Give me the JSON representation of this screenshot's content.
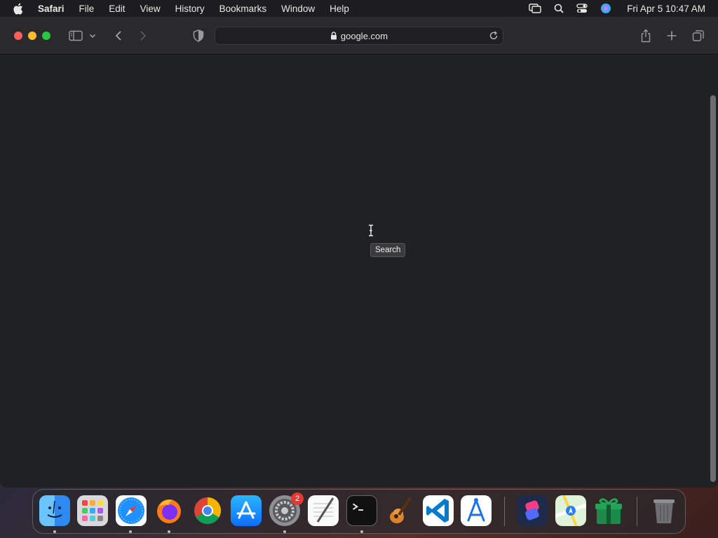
{
  "menubar": {
    "app_name": "Safari",
    "items": [
      "File",
      "Edit",
      "View",
      "History",
      "Bookmarks",
      "Window",
      "Help"
    ],
    "clock": "Fri Apr 5  10:47 AM"
  },
  "toolbar": {
    "url": "google.com"
  },
  "tooltip": {
    "text": "Search"
  },
  "dock": {
    "items": [
      "Finder",
      "Launchpad",
      "Safari",
      "Firefox",
      "Google Chrome",
      "App Store",
      "System Settings",
      "TextEdit",
      "Terminal",
      "GarageBand",
      "Visual Studio Code",
      "Xcode Instruments",
      "Shortcuts",
      "Maps",
      "Gift",
      "Trash"
    ],
    "settings_badge": "2"
  },
  "colors": {
    "menubar_bg": "#1d1d1f",
    "toolbar_bg": "#2a2a2d",
    "content_bg": "#202124"
  }
}
